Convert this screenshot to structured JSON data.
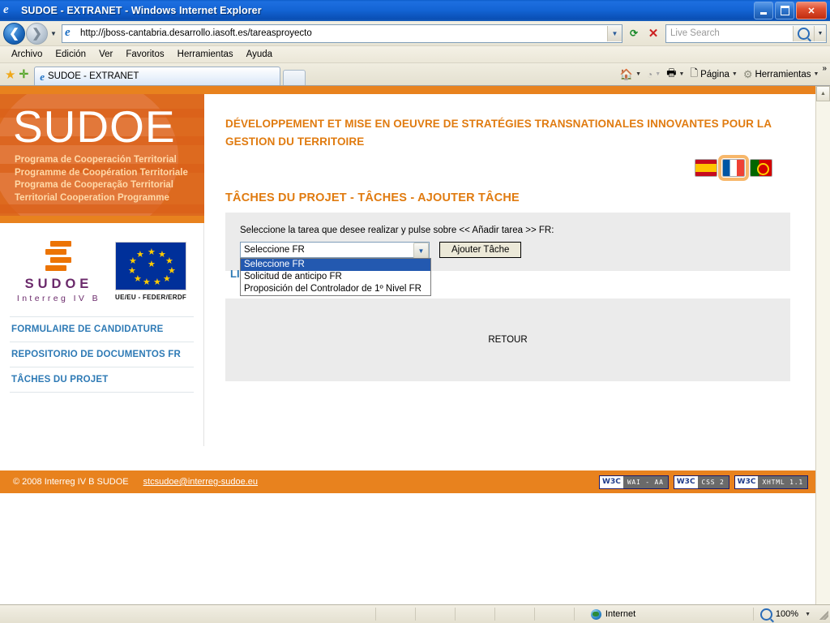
{
  "browser": {
    "window_title": "SUDOE - EXTRANET - Windows Internet Explorer",
    "url": "http://jboss-cantabria.desarrollo.iasoft.es/tareasproyecto",
    "search_placeholder": "Live Search",
    "menus": [
      "Archivo",
      "Edición",
      "Ver",
      "Favoritos",
      "Herramientas",
      "Ayuda"
    ],
    "tab_title": "SUDOE - EXTRANET",
    "commands": [
      "Página",
      "Herramientas"
    ],
    "minimize_label": "Minimizar",
    "maximize_label": "Maximizar",
    "close_label": "Cerrar"
  },
  "status": {
    "zone": "Internet",
    "zoom": "100%"
  },
  "banner": {
    "wordmark": "SUDOE",
    "taglines": [
      "Programa de Cooperación Territorial",
      "Programme de Coopération Territoriale",
      "Programa de Cooperação Territorial",
      "Territorial Cooperation Programme"
    ]
  },
  "sidebar": {
    "logo_name": "SUDOE",
    "logo_sub": "Interreg IV B",
    "eu_caption": "UE/EU - FEDER/ERDF",
    "items": [
      {
        "label": "FORMULAIRE DE CANDIDATURE"
      },
      {
        "label": "REPOSITORIO DE DOCUMENTOS FR"
      },
      {
        "label": "TÂCHES DU PROJET"
      }
    ]
  },
  "main": {
    "subtitle": "DÉVELOPPEMENT ET MISE EN OEUVRE DE STRATÉGIES TRANSNATIONALES INNOVANTES POUR LA GESTION DU TERRITOIRE",
    "title": "TÂCHES DU PROJET - TÂCHES - AJOUTER TÂCHE",
    "languages": [
      {
        "code": "es",
        "label": "Español",
        "selected": false
      },
      {
        "code": "fr",
        "label": "Français",
        "selected": true
      },
      {
        "code": "pt",
        "label": "Português",
        "selected": false
      }
    ],
    "form": {
      "instruction": "Seleccione la tarea que desee realizar y pulse sobre << Añadir tarea >> FR:",
      "select_value": "Seleccione FR",
      "options": [
        {
          "label": "Seleccione FR",
          "selected": true
        },
        {
          "label": "Solicitud de anticipo FR",
          "selected": false
        },
        {
          "label": "Proposición del Controlador de 1º Nivel FR",
          "selected": false
        }
      ],
      "add_button": "Ajouter Tâche"
    },
    "obscured_text": "LIS",
    "back_button": "RETOUR"
  },
  "footer": {
    "copyright": "© 2008 Interreg IV B SUDOE",
    "email": "stcsudoe@interreg-sudoe.eu",
    "badges": [
      {
        "left": "W3C",
        "right": "WAI - AA"
      },
      {
        "left": "W3C",
        "right": "CSS 2"
      },
      {
        "left": "W3C",
        "right": "XHTML 1.1"
      }
    ]
  },
  "colors": {
    "orange": "#e8821e",
    "banner_orange": "#dd6a1f",
    "link_blue": "#2e7ab5",
    "title_orange": "#e07b10",
    "panel_gray": "#ebebeb"
  }
}
